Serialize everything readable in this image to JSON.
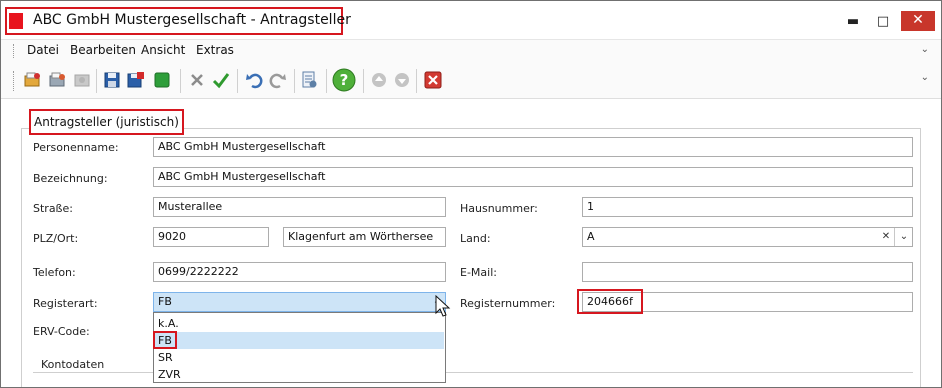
{
  "window": {
    "title": "ABC GmbH Mustergesellschaft - Antragsteller",
    "minimize_label": "▬",
    "maximize_label": "□",
    "close_label": "✕"
  },
  "menu": {
    "items": [
      "Datei",
      "Bearbeiten",
      "Ansicht",
      "Extras"
    ]
  },
  "toolbar": {
    "icons": [
      "open-folder-icon",
      "open-icon",
      "open-disabled-icon",
      "save-icon",
      "save-close-icon",
      "green-square-icon",
      "cancel-x-icon",
      "confirm-check-icon",
      "undo-icon",
      "redo-icon",
      "preview-icon",
      "help-icon",
      "up-icon",
      "down-icon",
      "close-red-icon"
    ]
  },
  "form": {
    "group_title": "Antragsteller (juristisch)",
    "personenname": {
      "label": "Personenname:",
      "value": "ABC GmbH Mustergesellschaft"
    },
    "bezeichnung": {
      "label": "Bezeichnung:",
      "value": "ABC GmbH Mustergesellschaft"
    },
    "strasse": {
      "label": "Straße:",
      "value": "Musterallee"
    },
    "hausnummer": {
      "label": "Hausnummer:",
      "value": "1"
    },
    "plz_ort": {
      "label": "PLZ/Ort:",
      "plz": "9020",
      "ort": "Klagenfurt am Wörthersee"
    },
    "land": {
      "label": "Land:",
      "value": "A"
    },
    "telefon": {
      "label": "Telefon:",
      "value": "0699/2222222"
    },
    "email": {
      "label": "E-Mail:",
      "value": ""
    },
    "registerart": {
      "label": "Registerart:",
      "value": "FB",
      "options": [
        "k.A.",
        "FB",
        "SR",
        "ZVR"
      ],
      "selected_index": 1
    },
    "registernummer": {
      "label": "Registernummer:",
      "value": "204666f"
    },
    "erv_code": {
      "label": "ERV-Code:"
    },
    "kontodaten": {
      "label": "Kontodaten"
    }
  },
  "colors": {
    "highlight": "#d6171f",
    "selection": "#cde4f7",
    "close_button": "#c8362b"
  }
}
